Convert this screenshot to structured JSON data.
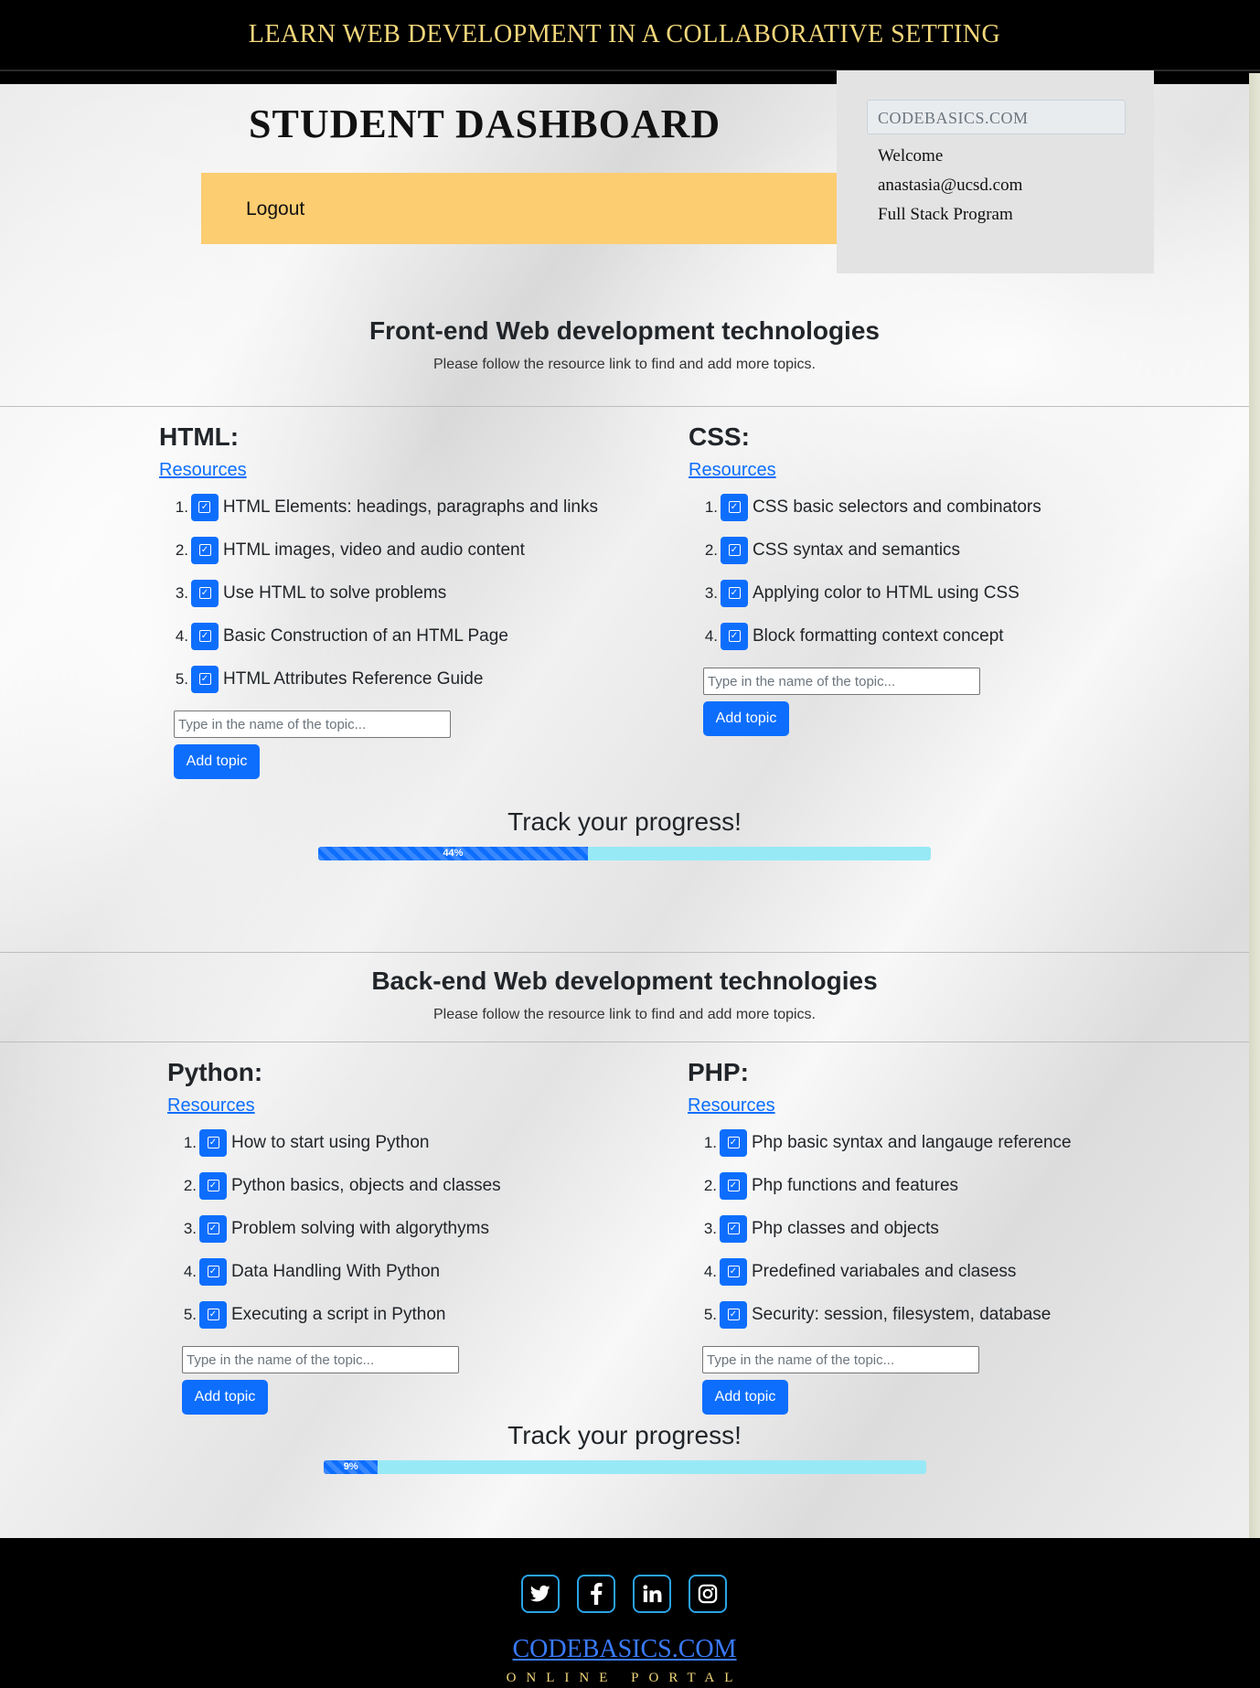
{
  "header": {
    "title": "LEARN WEB DEVELOPMENT IN A COLLABORATIVE SETTING"
  },
  "dashboard": {
    "title": "STUDENT DASHBOARD",
    "logout_label": "Logout"
  },
  "profile": {
    "brand": "CODEBASICS.COM",
    "welcome": "Welcome",
    "email": "anastasia@ucsd.com",
    "program": "Full Stack Program"
  },
  "frontend": {
    "title": "Front-end Web development technologies",
    "subtitle": "Please follow the resource link to find and add more topics.",
    "columns": [
      {
        "heading": "HTML:",
        "resources_label": "Resources",
        "topics": [
          "HTML Elements: headings, paragraphs and links",
          "HTML images, video and audio content",
          "Use HTML to solve problems",
          "Basic Construction of an HTML Page",
          "HTML Attributes Reference Guide"
        ],
        "input_placeholder": "Type in the name of the topic...",
        "add_label": "Add topic"
      },
      {
        "heading": "CSS:",
        "resources_label": "Resources",
        "topics": [
          "CSS basic selectors and combinators",
          "CSS syntax and semantics",
          "Applying color to HTML using CSS",
          "Block formatting context concept"
        ],
        "input_placeholder": "Type in the name of the topic...",
        "add_label": "Add topic"
      }
    ],
    "progress": {
      "title": "Track your progress!",
      "percent": 44,
      "label": "44%"
    }
  },
  "backend": {
    "title": "Back-end Web development technologies",
    "subtitle": "Please follow the resource link to find and add more topics.",
    "columns": [
      {
        "heading": "Python:",
        "resources_label": "Resources",
        "topics": [
          "How to start using Python",
          "Python basics, objects and classes",
          "Problem solving with algorythyms",
          "Data Handling With Python",
          "Executing a script in Python"
        ],
        "input_placeholder": "Type in the name of the topic...",
        "add_label": "Add topic"
      },
      {
        "heading": "PHP:",
        "resources_label": "Resources",
        "topics": [
          "Php basic syntax and langauge reference",
          "Php functions and features",
          "Php classes and objects",
          "Predefined variabales and clasess",
          "Security: session, filesystem, database"
        ],
        "input_placeholder": "Type in the name of the topic...",
        "add_label": "Add topic"
      }
    ],
    "progress": {
      "title": "Track your progress!",
      "percent": 9,
      "label": "9%"
    }
  },
  "footer": {
    "social_icons": [
      "twitter-icon",
      "facebook-icon",
      "linkedin-icon",
      "instagram-icon"
    ],
    "brand": "CODEBASICS.COM",
    "tagline": "ONLINE PORTAL"
  },
  "colors": {
    "accent": "#0d6efd",
    "header_text": "#f3d77a",
    "logout_bar": "#fdcd71",
    "progress_track": "#98e9f6"
  }
}
